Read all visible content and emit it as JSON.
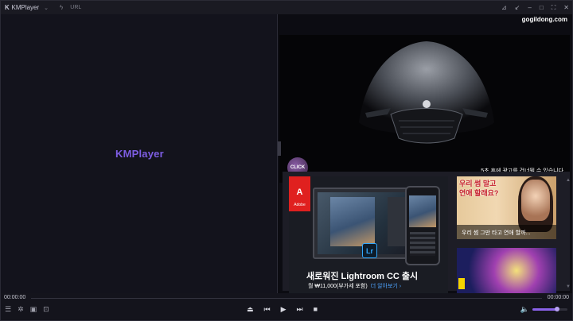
{
  "titlebar": {
    "app_name": "KMPlayer",
    "url_label": "URL",
    "icons": [
      "kmp-mark-icon",
      "chevron-down-icon",
      "bolt-icon",
      "pin-icon",
      "shrink-icon",
      "minimize-icon",
      "maximize-icon",
      "fullscreen-icon",
      "close-icon"
    ]
  },
  "video": {
    "logo_text": "KMPlayer"
  },
  "side_panel": {
    "domain": "gogildong.com",
    "ad_video": {
      "badge": "CLICK",
      "skip_text": "5초 후에 광고를 건너뛸 수 있습니다."
    },
    "lightroom_ad": {
      "brand": "Adobe",
      "brand_mark": "A",
      "app_icon": "Lr",
      "headline": "새로워진 Lightroom CC 출시",
      "price": "월 ₩11,000(부가세 포함)",
      "more": "더 알아보기 ›"
    },
    "thumb1": {
      "overlay_line1": "우리 썸 말고",
      "overlay_line2": "연애 할래요?",
      "caption": "우리 썸 그만 타고 연애 할까..."
    }
  },
  "timebar": {
    "elapsed": "00:00:00",
    "total": "00:00:00"
  },
  "controls": {
    "volume_level": 0.7,
    "accent_color": "#8a62e9",
    "logo_color": "#7d5de3"
  }
}
